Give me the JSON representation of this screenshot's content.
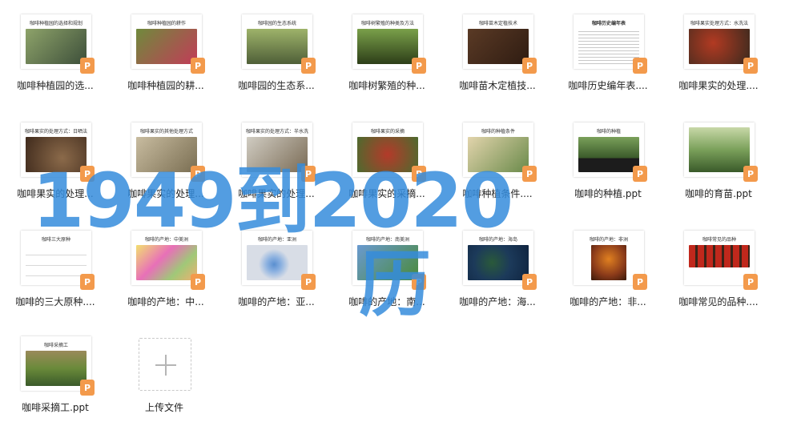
{
  "files": [
    {
      "name": "咖啡种植园的选...",
      "thumb_title": "咖啡种植园的选择和规划",
      "colors": [
        "#6b7d55",
        "#3d4f3a"
      ]
    },
    {
      "name": "咖啡种植园的耕...",
      "thumb_title": "咖啡种植园的耕作",
      "colors": [
        "#6f8a3c",
        "#c23c58"
      ]
    },
    {
      "name": "咖啡园的生态系...",
      "thumb_title": "咖啡园的生态系统",
      "colors": [
        "#4f5f38",
        "#9eb36a"
      ]
    },
    {
      "name": "咖啡树繁殖的种...",
      "thumb_title": "咖啡树繁殖的种类及方法",
      "colors": [
        "#557d2a",
        "#2d3e18"
      ]
    },
    {
      "name": "咖啡苗木定植技...",
      "thumb_title": "咖啡苗木定植技术",
      "colors": [
        "#5a3a25",
        "#2f1c12"
      ]
    },
    {
      "name": "咖啡历史编年表....",
      "thumb_title": "咖啡历史编年表",
      "colors": [
        "#ffffff",
        "#ffffff"
      ]
    },
    {
      "name": "咖啡果实的处理....",
      "thumb_title": "咖啡果实处理方式：水洗法",
      "colors": [
        "#8b2a1c",
        "#3a2a1e"
      ]
    },
    {
      "name": "咖啡果实的处理...",
      "thumb_title": "咖啡果实的处理方式：日晒法",
      "colors": [
        "#8b6a4a",
        "#3f2a1c"
      ]
    },
    {
      "name": "咖啡果实的处理...",
      "thumb_title": "咖啡果实的其他处理方式",
      "colors": [
        "#9a8e72",
        "#c8bca0"
      ]
    },
    {
      "name": "咖啡果实的处理...",
      "thumb_title": "咖啡果实的处理方式：半水洗",
      "colors": [
        "#b8b2a6",
        "#7a6b55"
      ]
    },
    {
      "name": "咖啡果实的采摘...",
      "thumb_title": "咖啡果实的采摘",
      "colors": [
        "#4c6b2e",
        "#b43a2a"
      ]
    },
    {
      "name": "咖啡种植条件....",
      "thumb_title": "咖啡的种植条件",
      "colors": [
        "#d9c9a0",
        "#6a8a4a"
      ]
    },
    {
      "name": "咖啡的种植.ppt",
      "thumb_title": "咖啡的种植",
      "colors": [
        "#3a5a2a",
        "#1c1c1c"
      ]
    },
    {
      "name": "咖啡的育苗.ppt",
      "thumb_title": "",
      "colors": [
        "#7aa05a",
        "#3a5a2a"
      ]
    },
    {
      "name": "咖啡的三大原种....",
      "thumb_title": "咖啡三大原种",
      "colors": [
        "#ffffff",
        "#ffffff"
      ]
    },
    {
      "name": "咖啡的产地：中...",
      "thumb_title": "咖啡的产地：中美洲",
      "colors": [
        "#e870b8",
        "#f2e070"
      ]
    },
    {
      "name": "咖啡的产地：亚...",
      "thumb_title": "咖啡的产地：亚洲",
      "colors": [
        "#d8dde6",
        "#5a8fd0"
      ]
    },
    {
      "name": "咖啡的产地：南...",
      "thumb_title": "咖啡的产地：南美洲",
      "colors": [
        "#6a9ad0",
        "#4a8a3a"
      ]
    },
    {
      "name": "咖啡的产地：海...",
      "thumb_title": "咖啡的产地：海岛",
      "colors": [
        "#1c3a5a",
        "#2a5a3a"
      ]
    },
    {
      "name": "咖啡的产地：非...",
      "thumb_title": "咖啡的产地：非洲",
      "colors": [
        "#8a3a1a",
        "#d0701a"
      ]
    },
    {
      "name": "咖啡常见的品种....",
      "thumb_title": "咖啡常见的品种",
      "colors": [
        "#8a1a14",
        "#3a2418"
      ]
    },
    {
      "name": "咖啡采摘工.ppt",
      "thumb_title": "咖啡采摘工",
      "colors": [
        "#6a8a3a",
        "#9a8a5a"
      ]
    }
  ],
  "upload_label": "上传文件",
  "ppt_glyph": "P",
  "watermark": {
    "line1": "1949到2020",
    "line2": "历"
  }
}
